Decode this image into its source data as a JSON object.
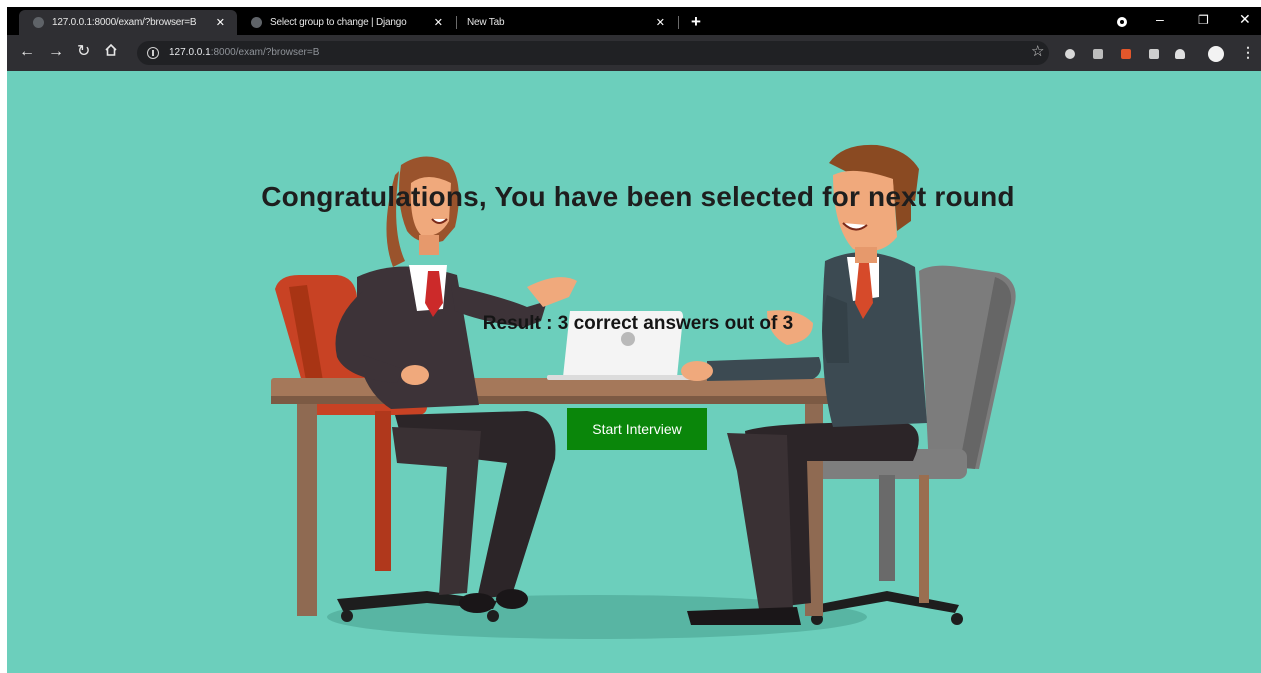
{
  "browser": {
    "tabs": [
      {
        "title": "127.0.0.1:8000/exam/?browser=B",
        "active": true
      },
      {
        "title": "Select group to change | Django",
        "active": false
      },
      {
        "title": "New Tab",
        "active": false
      }
    ],
    "new_tab_glyph": "+",
    "close_glyph": "✕",
    "url_host": "127.0.0.1",
    "url_rest": ":8000/exam/?browser=B",
    "window_controls": {
      "minimize": "–",
      "restore": "❐",
      "close": "✕"
    },
    "icons": [
      "back-icon",
      "forward-icon",
      "reload-icon",
      "home-icon",
      "info-icon",
      "bookmark-star-icon",
      "extension-icons",
      "profile-avatar-icon",
      "menu-icon"
    ]
  },
  "page": {
    "background_color": "#6ccfbc",
    "heading": "Congratulations, You have been selected for next round",
    "result_text": "Result : 3 correct answers out of 3",
    "start_button_label": "Start Interview",
    "start_button_color": "#0a860a"
  }
}
